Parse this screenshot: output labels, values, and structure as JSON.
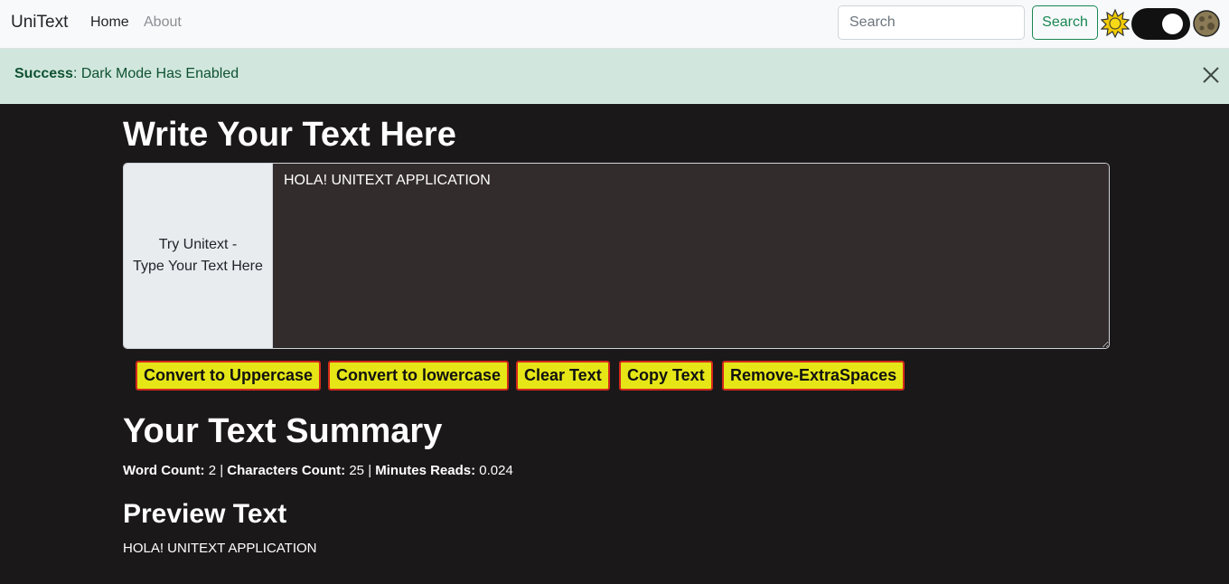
{
  "navbar": {
    "brand": "UniText",
    "links": [
      "Home",
      "About"
    ],
    "search_placeholder": "Search",
    "search_button": "Search",
    "sun_icon": "sun-icon",
    "moon_icon": "moon-icon",
    "dark_mode_enabled": true
  },
  "alert": {
    "type": "Success",
    "message": ": Dark Mode Has Enabled"
  },
  "main": {
    "heading": "Write Your Text Here",
    "input_label_line1": "Try Unitext -",
    "input_label_line2": "Type Your Text Here",
    "textarea_value": "HOLA! UNITEXT APPLICATION",
    "buttons": [
      "Convert to Uppercase",
      "Convert to lowercase",
      "Clear Text",
      "Copy Text",
      "Remove-ExtraSpaces"
    ],
    "summary_heading": "Your Text Summary",
    "word_count_label": "Word Count:",
    "word_count": "2",
    "char_count_label": "Characters Count:",
    "char_count": "25",
    "minutes_label": "Minutes Reads:",
    "minutes": "0.024",
    "separator": "|",
    "preview_heading": "Preview Text",
    "preview_text": "HOLA! UNITEXT APPLICATION"
  },
  "colors": {
    "background": "#1a1819",
    "textarea_bg": "#332c2d",
    "button_bg": "#e6e617",
    "button_border": "#d42a1c",
    "alert_bg": "#d1e7dd",
    "alert_text": "#0f5132"
  }
}
